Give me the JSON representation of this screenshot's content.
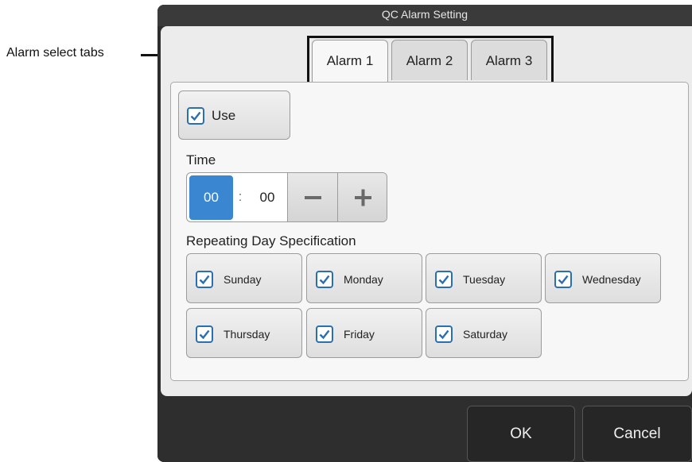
{
  "annotation": {
    "label": "Alarm select tabs"
  },
  "dialog": {
    "title": "QC Alarm Setting"
  },
  "tabs": [
    {
      "label": "Alarm 1",
      "active": true
    },
    {
      "label": "Alarm 2",
      "active": false
    },
    {
      "label": "Alarm 3",
      "active": false
    }
  ],
  "use": {
    "label": "Use",
    "checked": true
  },
  "time": {
    "label": "Time",
    "hour": "00",
    "separator": ":",
    "minute": "00"
  },
  "repeat": {
    "label": "Repeating Day Specification",
    "days": [
      {
        "label": "Sunday",
        "checked": true
      },
      {
        "label": "Monday",
        "checked": true
      },
      {
        "label": "Tuesday",
        "checked": true
      },
      {
        "label": "Wednesday",
        "checked": true
      },
      {
        "label": "Thursday",
        "checked": true
      },
      {
        "label": "Friday",
        "checked": true
      },
      {
        "label": "Saturday",
        "checked": true
      }
    ]
  },
  "footer": {
    "ok_label": "OK",
    "cancel_label": "Cancel"
  },
  "colors": {
    "accent": "#3a86d0",
    "check_border": "#2a6fb0",
    "dialog_bg": "#2e2e2e"
  },
  "icons": {
    "check": "check-icon",
    "minus": "minus-icon",
    "plus": "plus-icon"
  }
}
